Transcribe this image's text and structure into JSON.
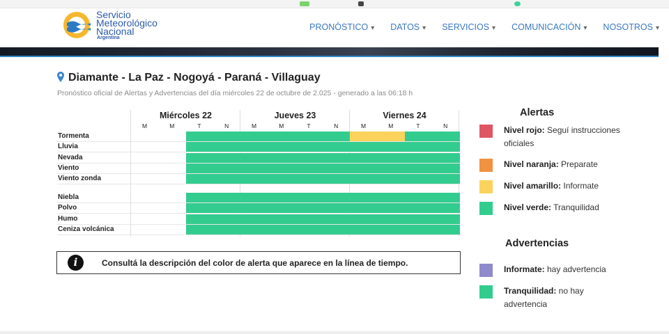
{
  "header": {
    "logo": {
      "line1": "Servicio",
      "line2": "Meteorológico",
      "line3": "Nacional",
      "line4": "Argentina"
    },
    "nav": [
      {
        "label": "PRONÓSTICO"
      },
      {
        "label": "DATOS"
      },
      {
        "label": "SERVICIOS"
      },
      {
        "label": "COMUNICACIÓN"
      },
      {
        "label": "NOSOTROS"
      }
    ]
  },
  "forecast": {
    "title": "Diamante - La Paz - Nogoyá - Paraná - Villaguay",
    "subtitle": "Pronóstico oficial de Alertas y Advertencias del día miércoles 22 de octubre de 2.025 - generado a las 06:18 h",
    "days": [
      {
        "label": "Miércoles 22",
        "slots": [
          "M",
          "M",
          "T",
          "N"
        ]
      },
      {
        "label": "Jueves 23",
        "slots": [
          "M",
          "M",
          "T",
          "N"
        ]
      },
      {
        "label": "Viernes 24",
        "slots": [
          "M",
          "M",
          "T",
          "N"
        ]
      }
    ],
    "hazards": [
      {
        "label": "Tormenta",
        "levels": [
          "none",
          "none",
          "verde",
          "verde",
          "verde",
          "verde",
          "verde",
          "verde",
          "amarillo",
          "amarillo",
          "verde",
          "verde"
        ]
      },
      {
        "label": "Lluvia",
        "levels": [
          "none",
          "none",
          "verde",
          "verde",
          "verde",
          "verde",
          "verde",
          "verde",
          "verde",
          "verde",
          "verde",
          "verde"
        ]
      },
      {
        "label": "Nevada",
        "levels": [
          "none",
          "none",
          "verde",
          "verde",
          "verde",
          "verde",
          "verde",
          "verde",
          "verde",
          "verde",
          "verde",
          "verde"
        ]
      },
      {
        "label": "Viento",
        "levels": [
          "none",
          "none",
          "verde",
          "verde",
          "verde",
          "verde",
          "verde",
          "verde",
          "verde",
          "verde",
          "verde",
          "verde"
        ]
      },
      {
        "label": "Viento zonda",
        "levels": [
          "none",
          "none",
          "verde",
          "verde",
          "verde",
          "verde",
          "verde",
          "verde",
          "verde",
          "verde",
          "verde",
          "verde"
        ]
      },
      {
        "label": "Niebla",
        "levels": [
          "none",
          "none",
          "verde",
          "verde",
          "verde",
          "verde",
          "verde",
          "verde",
          "verde",
          "verde",
          "verde",
          "verde"
        ]
      },
      {
        "label": "Polvo",
        "levels": [
          "none",
          "none",
          "verde",
          "verde",
          "verde",
          "verde",
          "verde",
          "verde",
          "verde",
          "verde",
          "verde",
          "verde"
        ]
      },
      {
        "label": "Humo",
        "levels": [
          "none",
          "none",
          "verde",
          "verde",
          "verde",
          "verde",
          "verde",
          "verde",
          "verde",
          "verde",
          "verde",
          "verde"
        ]
      },
      {
        "label": "Ceniza volcánica",
        "levels": [
          "none",
          "none",
          "verde",
          "verde",
          "verde",
          "verde",
          "verde",
          "verde",
          "verde",
          "verde",
          "verde",
          "verde"
        ]
      }
    ],
    "info_text": "Consultá la descripción del color de alerta que aparece en la línea de tiempo."
  },
  "colors": {
    "rojo": "#de5563",
    "naranja": "#f0923f",
    "amarillo": "#fbd25c",
    "verde": "#33cc8f",
    "violeta": "#8f8acb",
    "brand": "#2b5ba8",
    "nav": "#3a78c0"
  },
  "legend": {
    "alertas_title": "Alertas",
    "alertas": [
      {
        "name": "Nivel rojo:",
        "desc": " Seguí instrucciones oficiales",
        "color": "rojo"
      },
      {
        "name": "Nivel naranja:",
        "desc": " Preparate",
        "color": "naranja"
      },
      {
        "name": "Nivel amarillo:",
        "desc": " Informate",
        "color": "amarillo"
      },
      {
        "name": "Nivel verde:",
        "desc": " Tranquilidad",
        "color": "verde"
      }
    ],
    "advertencias_title": "Advertencias",
    "advertencias": [
      {
        "name": "Informate:",
        "desc": " hay advertencia",
        "color": "violeta"
      },
      {
        "name": "Tranquilidad:",
        "desc": " no hay advertencia",
        "color": "verde"
      }
    ]
  }
}
